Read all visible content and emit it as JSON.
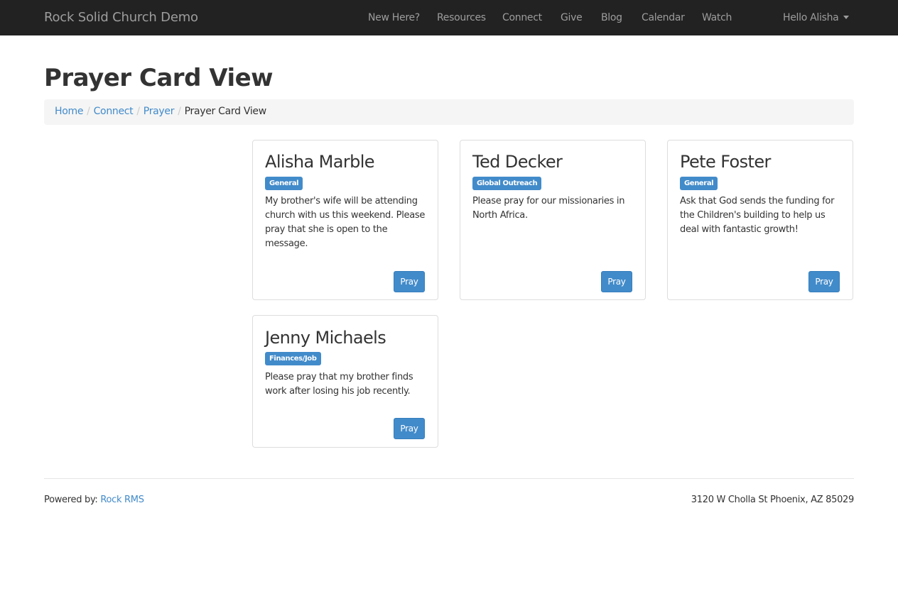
{
  "navbar": {
    "brand": "Rock Solid Church Demo",
    "items": [
      {
        "label": "New Here?"
      },
      {
        "label": "Resources"
      },
      {
        "label": "Connect"
      },
      {
        "label": "Give"
      },
      {
        "label": "Blog"
      },
      {
        "label": "Calendar"
      },
      {
        "label": "Watch"
      }
    ],
    "user_menu": "Hello Alisha",
    "user_menu_icon": "caret-down-icon"
  },
  "page": {
    "title": "Prayer Card View"
  },
  "breadcrumb": {
    "items": [
      {
        "label": "Home"
      },
      {
        "label": "Connect"
      },
      {
        "label": "Prayer"
      }
    ],
    "separator": "/",
    "active": "Prayer Card View"
  },
  "cards": [
    {
      "name": "Alisha Marble",
      "category": "General",
      "text": "My brother's wife will be attending church with us this weekend. Please pray that she is open to the message.",
      "button": "Pray"
    },
    {
      "name": "Ted Decker",
      "category": "Global Outreach",
      "text": "Please pray for our missionaries in North Africa.",
      "button": "Pray"
    },
    {
      "name": "Pete Foster",
      "category": "General",
      "text": "Ask that God sends the funding for the Children's building to help us deal with fantastic growth!",
      "button": "Pray"
    },
    {
      "name": "Jenny Michaels",
      "category": "Finances/Job",
      "text": "Please pray that my brother finds work after losing his job recently.",
      "button": "Pray"
    }
  ],
  "footer": {
    "powered_by_label": "Powered by:",
    "powered_by_link": "Rock RMS",
    "address": "3120 W Cholla St Phoenix, AZ 85029"
  },
  "colors": {
    "navbar_bg": "#222222",
    "accent": "#428bca",
    "breadcrumb_bg": "#f5f5f5"
  }
}
